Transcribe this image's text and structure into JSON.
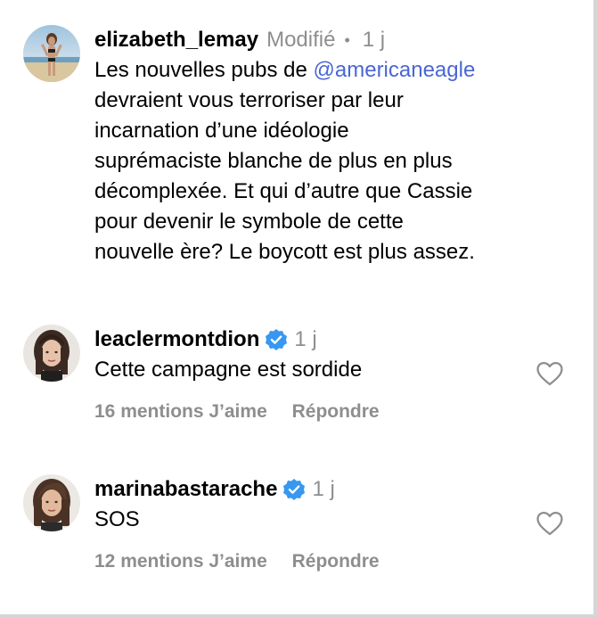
{
  "comments": [
    {
      "username": "elizabeth_lemay",
      "edited": "Modifié",
      "separator": "•",
      "time": "1 j",
      "lines": [
        "devraient vous terroriser par leur",
        "incarnation d’une idéologie",
        "suprémaciste blanche de plus en plus",
        "décomplexée. Et qui d’autre que Cassie",
        "pour devenir le symbole de cette",
        "nouvelle ère? Le boycott est plus assez."
      ],
      "first_line_prefix": "Les nouvelles pubs de ",
      "mention": "@americaneagle"
    },
    {
      "username": "leaclermontdion",
      "verified": true,
      "time": "1 j",
      "text": "Cette campagne est sordide",
      "likes": "16 mentions J’aime",
      "reply": "Répondre"
    },
    {
      "username": "marinabastarache",
      "verified": true,
      "time": "1 j",
      "text": "SOS",
      "likes": "12 mentions J’aime",
      "reply": "Répondre"
    }
  ],
  "colors": {
    "mention": "#4a66d6",
    "meta_gray": "#8e8e8e",
    "verified_blue": "#3897f0"
  },
  "icons": [
    "verified-badge-icon",
    "heart-outline-icon"
  ]
}
